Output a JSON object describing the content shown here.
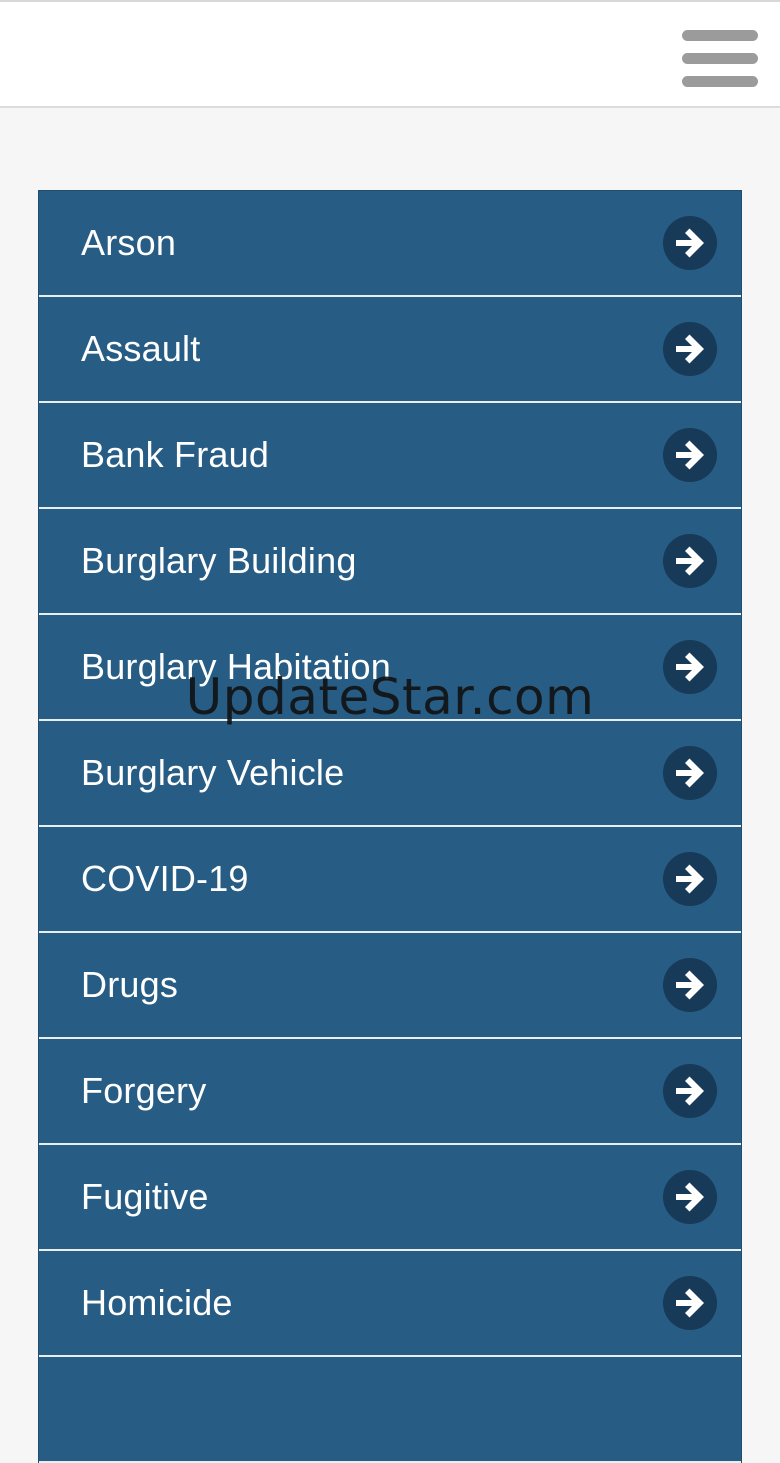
{
  "header": {
    "menu_icon": "hamburger-menu-icon"
  },
  "list": {
    "arrow_icon": "arrow-right-circle-icon",
    "items": [
      {
        "label": "Arson"
      },
      {
        "label": "Assault"
      },
      {
        "label": "Bank Fraud"
      },
      {
        "label": "Burglary Building"
      },
      {
        "label": "Burglary Habitation"
      },
      {
        "label": "Burglary Vehicle"
      },
      {
        "label": "COVID-19"
      },
      {
        "label": "Drugs"
      },
      {
        "label": "Forgery"
      },
      {
        "label": "Fugitive"
      },
      {
        "label": "Homicide"
      },
      {
        "label": ""
      }
    ]
  },
  "watermark": {
    "text": "UpdateStar.com"
  },
  "colors": {
    "list_background": "#275d85",
    "arrow_circle": "#163a57",
    "page_background": "#f6f6f6",
    "menu_icon": "#9b9b9b"
  }
}
